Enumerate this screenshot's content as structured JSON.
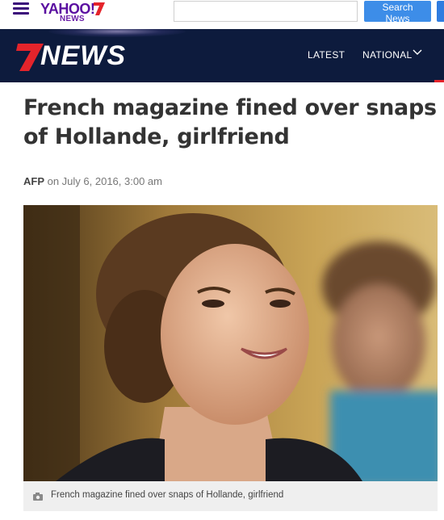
{
  "topbar": {
    "yahoo_word": "YAHOO!",
    "yahoo_sub": "NEWS",
    "search_placeholder": "",
    "search_button": "Search News"
  },
  "nav": {
    "brand": "NEWS",
    "items": [
      {
        "label": "LATEST"
      },
      {
        "label": "NATIONAL"
      }
    ]
  },
  "article": {
    "headline": "French magazine fined over snaps of Hollande, girlfriend",
    "source": "AFP",
    "date": " on July 6, 2016, 3:00 am",
    "caption": "French magazine fined over snaps of Hollande, girlfriend"
  },
  "colors": {
    "nav_bg": "#0d1b3d",
    "brand_red": "#e4242b",
    "yahoo_purple": "#5a0fa0",
    "search_blue": "#3d8de8"
  }
}
